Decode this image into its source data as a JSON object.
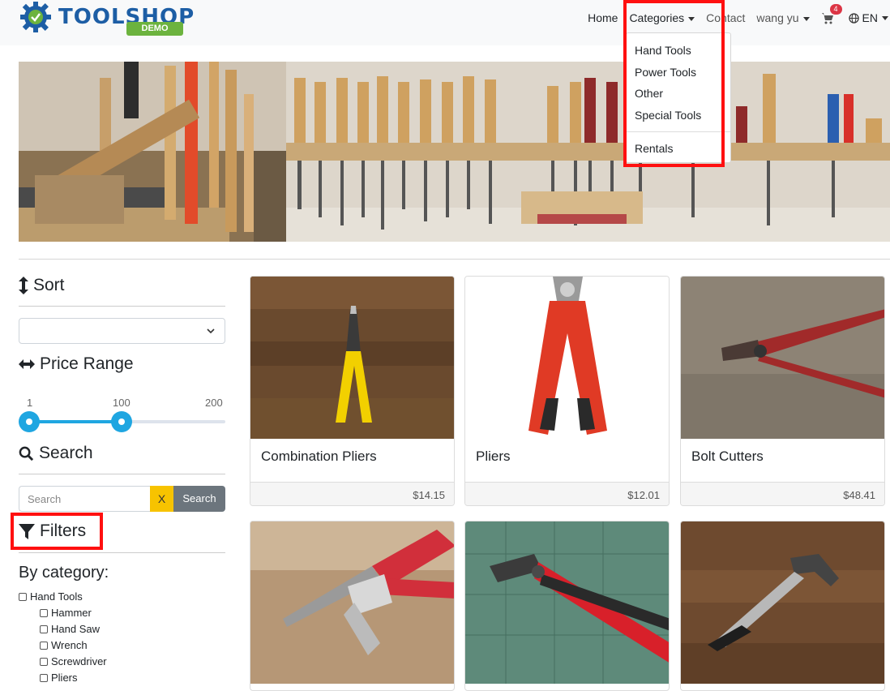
{
  "brand": {
    "name": "TOOLSHOP",
    "badge": "DEMO"
  },
  "nav": {
    "home": "Home",
    "categories": "Categories",
    "contact": "Contact",
    "user": "wang yu",
    "cart_count": "4",
    "language": "EN"
  },
  "categories_menu": {
    "items": [
      "Hand Tools",
      "Power Tools",
      "Other",
      "Special Tools"
    ],
    "extra": "Rentals"
  },
  "sidebar": {
    "sort_heading": "Sort",
    "sort_value": "",
    "price_heading": "Price Range",
    "price_min": "1",
    "price_selected": "100",
    "price_max": "200",
    "search_heading": "Search",
    "search_placeholder": "Search",
    "clear_label": "X",
    "search_button": "Search",
    "filters_heading": "Filters",
    "by_category": "By category:",
    "category_root": "Hand Tools",
    "subcategories": [
      "Hammer",
      "Hand Saw",
      "Wrench",
      "Screwdriver",
      "Pliers"
    ]
  },
  "products": [
    {
      "name": "Combination Pliers",
      "price": "$14.15"
    },
    {
      "name": "Pliers",
      "price": "$12.01"
    },
    {
      "name": "Bolt Cutters",
      "price": "$48.41"
    },
    {
      "name": "",
      "price": ""
    },
    {
      "name": "",
      "price": ""
    },
    {
      "name": "",
      "price": ""
    }
  ],
  "colors": {
    "brand_blue": "#1d5ea5",
    "brand_green": "#6cb33e",
    "slider_blue": "#1fa6e1",
    "highlight_red": "#ff1010",
    "clear_yellow": "#f7c300"
  }
}
